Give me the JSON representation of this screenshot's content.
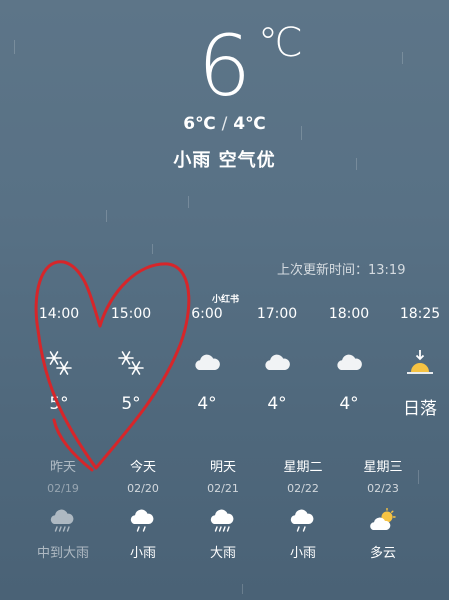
{
  "current": {
    "temperature": "6",
    "unit": "℃",
    "high": "6℃",
    "separator": "/",
    "low": "4℃",
    "condition": "小雨",
    "air_quality": "空气优"
  },
  "updated": "上次更新时间：13:19",
  "watermark": "小红书",
  "hourly": [
    {
      "time": "14:00",
      "icon": "snow-icon",
      "temp": "5°"
    },
    {
      "time": "15:00",
      "icon": "snow-icon",
      "temp": "5°"
    },
    {
      "time": "6:00",
      "icon": "cloud-icon",
      "temp": "4°"
    },
    {
      "time": "17:00",
      "icon": "cloud-icon",
      "temp": "4°"
    },
    {
      "time": "18:00",
      "icon": "cloud-icon",
      "temp": "4°"
    },
    {
      "time": "18:25",
      "icon": "sunset-icon",
      "temp": "日落"
    }
  ],
  "daily": [
    {
      "name": "昨天",
      "date": "02/19",
      "icon": "heavy-rain-icon",
      "cond": "中到大雨"
    },
    {
      "name": "今天",
      "date": "02/20",
      "icon": "light-rain-icon",
      "cond": "小雨"
    },
    {
      "name": "明天",
      "date": "02/21",
      "icon": "heavy-rain-icon",
      "cond": "大雨"
    },
    {
      "name": "星期二",
      "date": "02/22",
      "icon": "light-rain-icon",
      "cond": "小雨"
    },
    {
      "name": "星期三",
      "date": "02/23",
      "icon": "partly-cloudy-icon",
      "cond": "多云"
    }
  ],
  "colors": {
    "heart": "#d6262a",
    "sun": "#f6c343",
    "cloud": "#ffffff"
  }
}
